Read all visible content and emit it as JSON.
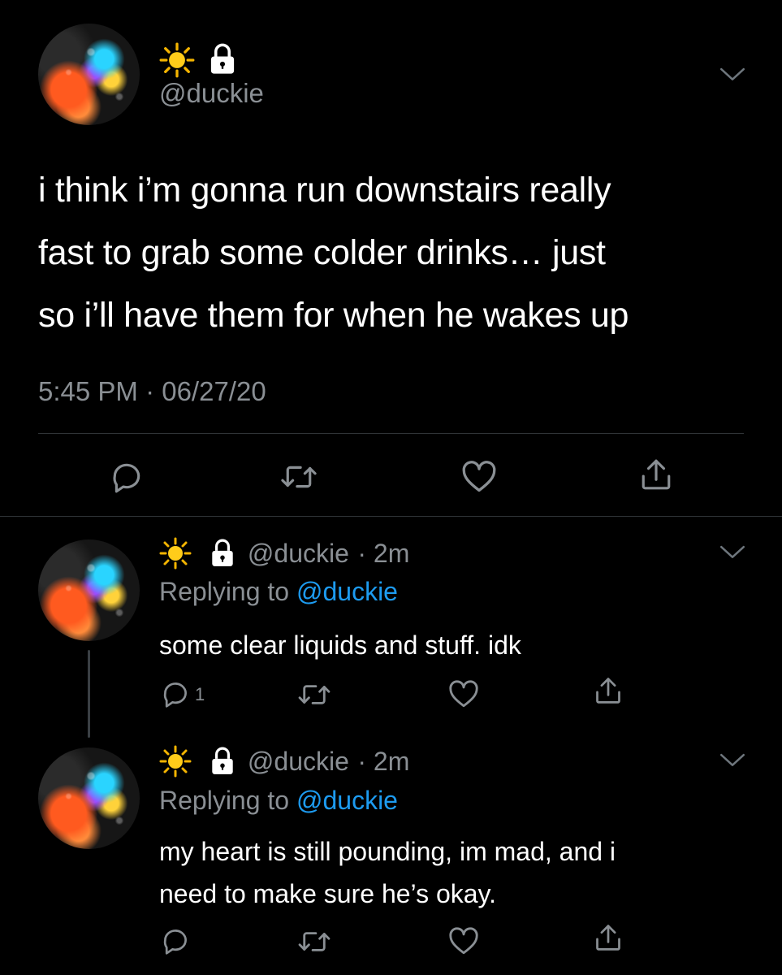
{
  "main_tweet": {
    "handle": "@duckie",
    "emoji_name": "sun-emoji",
    "text_line1": "i think i’m gonna run downstairs really",
    "text_line2": "fast to grab some colder drinks… just",
    "text_line3": "so i’ll have them for when he wakes up",
    "timestamp": "5:45 PM · 06/27/20"
  },
  "replies": [
    {
      "handle": "@duckie",
      "time": "· 2m",
      "replying_prefix": "Replying to",
      "replying_to": "@duckie",
      "text_line1": "some clear liquids and stuff. idk",
      "text_line2": "",
      "reply_count": "1"
    },
    {
      "handle": "@duckie",
      "time": "· 2m",
      "replying_prefix": "Replying to",
      "replying_to": "@duckie",
      "text_line1": "my heart is still pounding, im mad, and i",
      "text_line2": "need to make sure he’s okay.",
      "reply_count": ""
    }
  ],
  "colors": {
    "background": "#000000",
    "text": "#ffffff",
    "secondary": "#8a8f94",
    "link": "#1d9bf0",
    "divider": "#2f3336"
  },
  "icons": [
    "sun-emoji",
    "lock-icon",
    "chevron-down-icon",
    "reply-icon",
    "retweet-icon",
    "like-icon",
    "share-icon"
  ]
}
